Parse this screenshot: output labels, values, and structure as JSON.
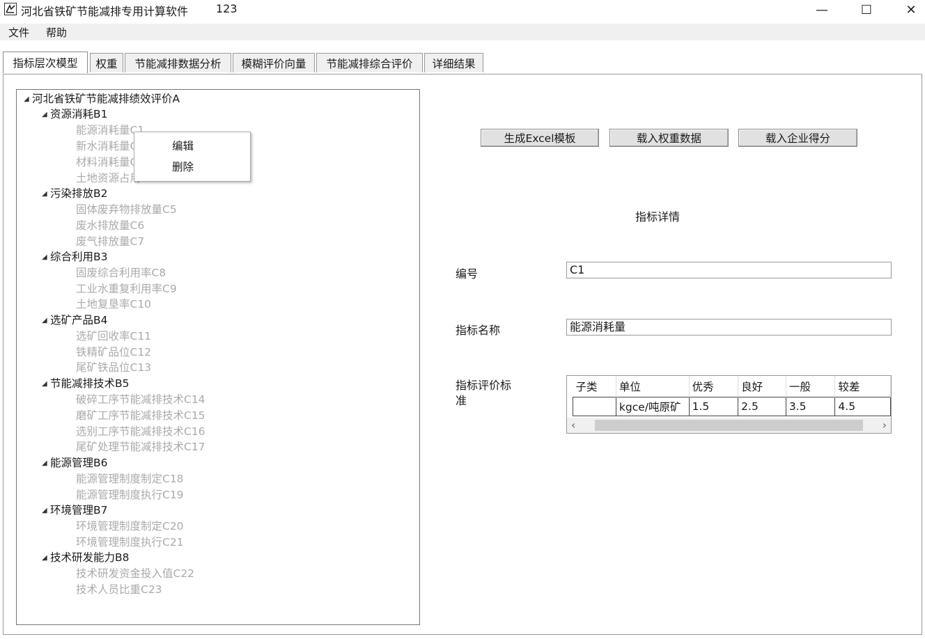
{
  "window": {
    "title": "河北省铁矿节能减排专用计算软件",
    "title_suffix": "123",
    "minimize": "—",
    "maximize": "☐",
    "close": "✕"
  },
  "menu": [
    "文件",
    "帮助"
  ],
  "tabs": [
    "指标层次模型",
    "权重",
    "节能减排数据分析",
    "模糊评价向量",
    "节能减排综合评价",
    "详细结果"
  ],
  "tree": {
    "root": "河北省铁矿节能减排绩效评价A",
    "groups": [
      {
        "label": "资源消耗B1",
        "children": [
          "能源消耗量C1",
          "新水消耗量C2",
          "材料消耗量C3",
          "土地资源占用C4"
        ]
      },
      {
        "label": "污染排放B2",
        "children": [
          "固体废弃物排放量C5",
          "废水排放量C6",
          "废气排放量C7"
        ]
      },
      {
        "label": "综合利用B3",
        "children": [
          "固废综合利用率C8",
          "工业水重复利用率C9",
          "土地复垦率C10"
        ]
      },
      {
        "label": "选矿产品B4",
        "children": [
          "选矿回收率C11",
          "铁精矿品位C12",
          "尾矿铁品位C13"
        ]
      },
      {
        "label": "节能减排技术B5",
        "children": [
          "破碎工序节能减排技术C14",
          "磨矿工序节能减排技术C15",
          "选别工序节能减排技术C16",
          "尾矿处理节能减排技术C17"
        ]
      },
      {
        "label": "能源管理B6",
        "children": [
          "能源管理制度制定C18",
          "能源管理制度执行C19"
        ]
      },
      {
        "label": "环境管理B7",
        "children": [
          "环境管理制度制定C20",
          "环境管理制度执行C21"
        ]
      },
      {
        "label": "技术研发能力B8",
        "children": [
          "技术研发资金投入值C22",
          "技术人员比重C23"
        ]
      }
    ]
  },
  "context_menu": [
    "编辑",
    "删除"
  ],
  "buttons": [
    "生成Excel模板",
    "载入权重数据",
    "载入企业得分"
  ],
  "details": {
    "heading": "指标详情",
    "id_label": "编号",
    "id_value": "C1",
    "name_label": "指标名称",
    "name_value": "能源消耗量",
    "standard_label_1": "指标评价标",
    "standard_label_2": "准"
  },
  "standard_table": {
    "headers": [
      "子类",
      "单位",
      "优秀",
      "良好",
      "一般",
      "较差"
    ],
    "row": [
      "",
      "kgce/吨原矿",
      "1.5",
      "2.5",
      "3.5",
      "4.5"
    ]
  }
}
